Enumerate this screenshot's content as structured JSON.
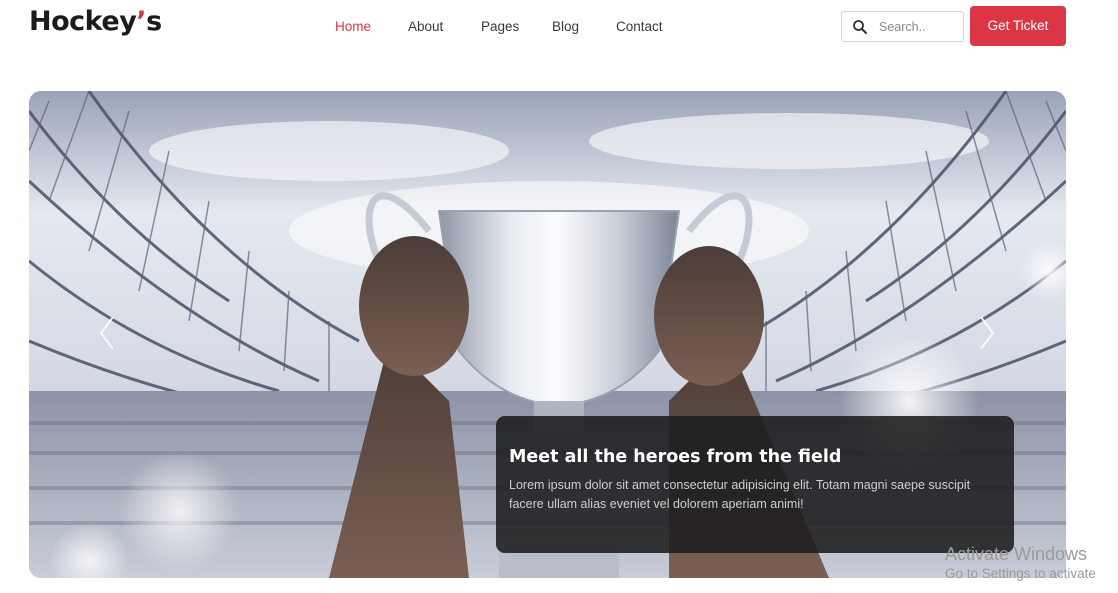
{
  "header": {
    "logo_text": "Hockey",
    "logo_apostrophe": "’",
    "logo_suffix": "s",
    "nav": [
      {
        "label": "Home",
        "active": true
      },
      {
        "label": "About",
        "active": false
      },
      {
        "label": "Pages",
        "active": false
      },
      {
        "label": "Blog",
        "active": false
      },
      {
        "label": "Contact",
        "active": false
      }
    ],
    "search_placeholder": "Search..",
    "ticket_label": "Get Ticket"
  },
  "hero": {
    "image": "trophy-raised-in-stadium",
    "caption_title": "Meet all the heroes from the field",
    "caption_text": "Lorem ipsum dolor sit amet consectetur adipisicing elit. Totam magni saepe suscipit facere ullam alias eveniet vel dolorem aperiam animi!"
  },
  "watermark": {
    "line1": "Activate Windows",
    "line2": "Go to Settings to activate"
  },
  "colors": {
    "accent": "#dc3545",
    "nav_text": "#3a3a3a",
    "caption_bg": "#1c1c1e"
  }
}
